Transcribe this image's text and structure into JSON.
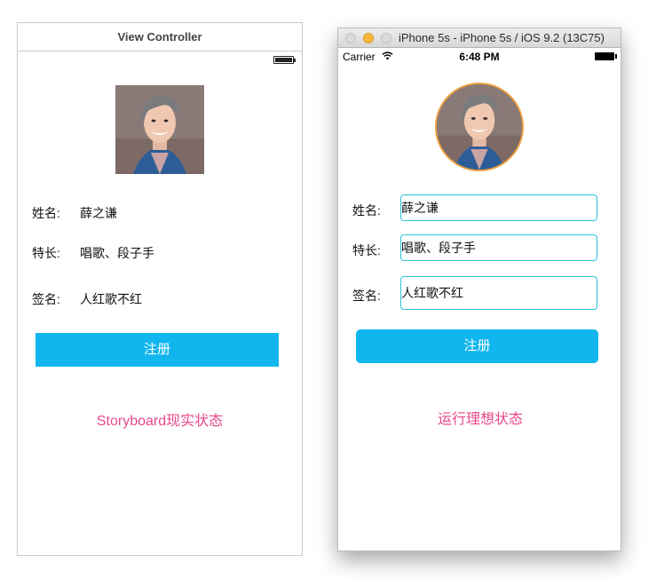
{
  "storyboard": {
    "title": "View Controller",
    "fields": [
      {
        "label": "姓名:",
        "value": "薛之谦"
      },
      {
        "label": "特长:",
        "value": "唱歌、段子手"
      },
      {
        "label": "签名:",
        "value": "人红歌不红"
      }
    ],
    "button_label": "注册",
    "caption": "Storyboard现实状态"
  },
  "simulator": {
    "window_title": "iPhone 5s - iPhone 5s / iOS 9.2 (13C75)",
    "status": {
      "carrier": "Carrier",
      "time": "6:48 PM"
    },
    "fields": [
      {
        "label": "姓名:",
        "value": "薛之谦"
      },
      {
        "label": "特长:",
        "value": "唱歌、段子手"
      },
      {
        "label": "签名:",
        "value": "人红歌不红"
      }
    ],
    "button_label": "注册",
    "caption": "运行理想状态"
  },
  "colors": {
    "button": "#12b6ee",
    "caption": "#e8488a",
    "field_border": "#2cc4d6",
    "avatar_ring": "#f0a040"
  },
  "icons": [
    "battery-icon",
    "wifi-icon",
    "avatar-image"
  ]
}
